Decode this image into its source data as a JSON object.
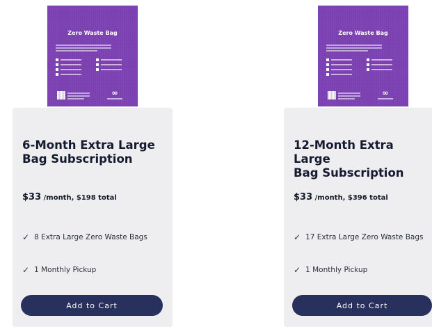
{
  "products": [
    {
      "bag_image": {
        "title": "Zero Waste Bag"
      },
      "title_line1": "6-Month Extra Large",
      "title_line2": "Bag Subscription",
      "price_amount": "$33",
      "price_suffix": "/month, $198 total",
      "features": [
        "8 Extra Large Zero Waste Bags",
        "1 Monthly Pickup"
      ],
      "cta_label": "Add to Cart"
    },
    {
      "bag_image": {
        "title": "Zero Waste Bag"
      },
      "title_line1": "12-Month Extra Large",
      "title_line2": "Bag Subscription",
      "price_amount": "$33",
      "price_suffix": "/month, $396 total",
      "features": [
        "17 Extra Large Zero Waste Bags",
        "1 Monthly Pickup"
      ],
      "cta_label": "Add to Cart"
    }
  ],
  "icons": {
    "check": "check-icon",
    "logo": "infinity-loop-logo",
    "qr": "qr-code-icon"
  },
  "colors": {
    "bag_purple": "#7a3fb0",
    "card_bg": "#eeeef0",
    "title_text": "#151b2e",
    "button_bg": "#28305e"
  }
}
